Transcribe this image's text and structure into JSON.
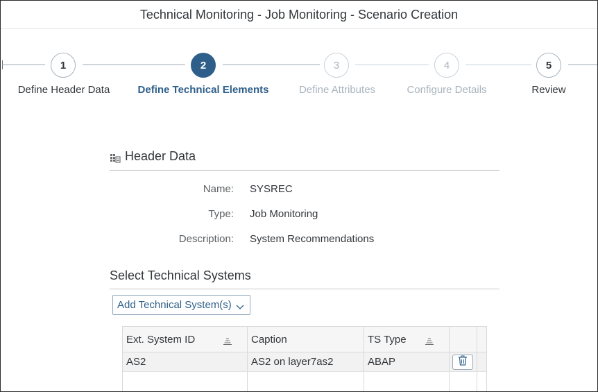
{
  "window": {
    "title": "Technical Monitoring - Job Monitoring - Scenario Creation"
  },
  "wizard": {
    "steps": [
      {
        "number": "1",
        "label": "Define Header Data",
        "state": "completed"
      },
      {
        "number": "2",
        "label": "Define Technical Elements",
        "state": "current"
      },
      {
        "number": "3",
        "label": "Define Attributes",
        "state": "future"
      },
      {
        "number": "4",
        "label": "Configure Details",
        "state": "future"
      },
      {
        "number": "5",
        "label": "Review",
        "state": "completed"
      }
    ]
  },
  "header_data": {
    "title": "Header Data",
    "fields": [
      {
        "label": "Name:",
        "value": "SYSREC"
      },
      {
        "label": "Type:",
        "value": "Job Monitoring"
      },
      {
        "label": "Description:",
        "value": "System Recommendations"
      }
    ]
  },
  "technical_systems": {
    "title": "Select Technical Systems",
    "add_button_label": "Add Technical System(s)",
    "columns": [
      "Ext. System ID",
      "Caption",
      "TS Type"
    ],
    "rows": [
      {
        "ext_system_id": "AS2",
        "caption": "AS2 on layer7as2",
        "ts_type": "ABAP"
      }
    ]
  },
  "colors": {
    "accent": "#2e5f8a",
    "future_step": "#a9b4be",
    "text": "#32363a"
  },
  "icons": {
    "header_data": "grid-document-icon",
    "sort": "sort-icon",
    "dropdown": "chevron-down-icon",
    "delete": "trash-icon"
  }
}
